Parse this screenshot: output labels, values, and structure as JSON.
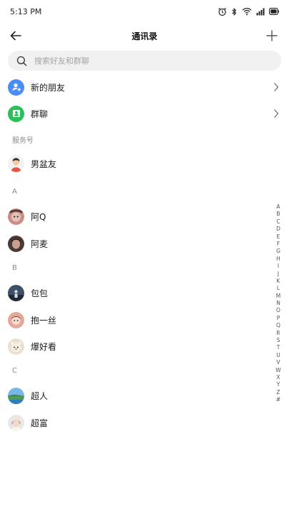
{
  "status": {
    "time": "5:13 PM"
  },
  "header": {
    "title": "通讯录"
  },
  "search": {
    "placeholder": "搜索好友和群聊"
  },
  "menu": [
    {
      "label": "新的朋友",
      "icon": "add-user-icon",
      "color": "#4a8df7"
    },
    {
      "label": "群聊",
      "icon": "group-icon",
      "color": "#2bbf59"
    }
  ],
  "service": {
    "header": "服务号",
    "items": [
      {
        "name": "男盆友"
      }
    ]
  },
  "groups": [
    {
      "letter": "A",
      "contacts": [
        {
          "name": "阿Q"
        },
        {
          "name": "阿麦"
        }
      ]
    },
    {
      "letter": "B",
      "contacts": [
        {
          "name": "包包"
        },
        {
          "name": "抱一丝"
        },
        {
          "name": "爆好看"
        }
      ]
    },
    {
      "letter": "C",
      "contacts": [
        {
          "name": "超人"
        },
        {
          "name": "超富"
        }
      ]
    }
  ],
  "index_letters": [
    "A",
    "B",
    "C",
    "D",
    "E",
    "F",
    "G",
    "H",
    "I",
    "J",
    "K",
    "L",
    "M",
    "N",
    "O",
    "P",
    "Q",
    "R",
    "S",
    "T",
    "U",
    "V",
    "W",
    "X",
    "Y",
    "Z",
    "#"
  ]
}
